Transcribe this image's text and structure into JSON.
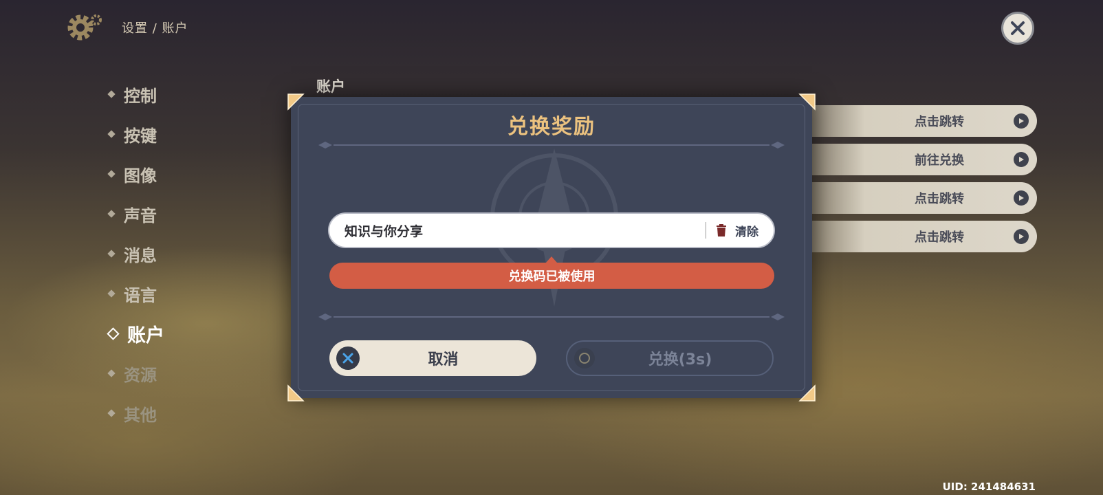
{
  "header": {
    "breadcrumb": "设置 / 账户"
  },
  "nav": {
    "items": [
      {
        "label": "控制"
      },
      {
        "label": "按键"
      },
      {
        "label": "图像"
      },
      {
        "label": "声音"
      },
      {
        "label": "消息"
      },
      {
        "label": "语言"
      },
      {
        "label": "账户",
        "active": true
      },
      {
        "label": "资源"
      },
      {
        "label": "其他"
      }
    ]
  },
  "main": {
    "section_title": "账户",
    "side_buttons": [
      {
        "label": "点击跳转"
      },
      {
        "label": "前往兑换"
      },
      {
        "label": "点击跳转"
      },
      {
        "label": "点击跳转"
      }
    ]
  },
  "dialog": {
    "title": "兑换奖励",
    "input_value": "知识与你分享",
    "clear_label": "清除",
    "error_message": "兑换码已被使用",
    "cancel_label": "取消",
    "redeem_label": "兑换(3s)"
  },
  "footer": {
    "uid": "UID: 241484631"
  },
  "colors": {
    "dialog_bg": "#3e4558",
    "title_gold": "#ecc27f",
    "error_red": "#d35d45",
    "cancel_bg": "#ece5d8"
  }
}
